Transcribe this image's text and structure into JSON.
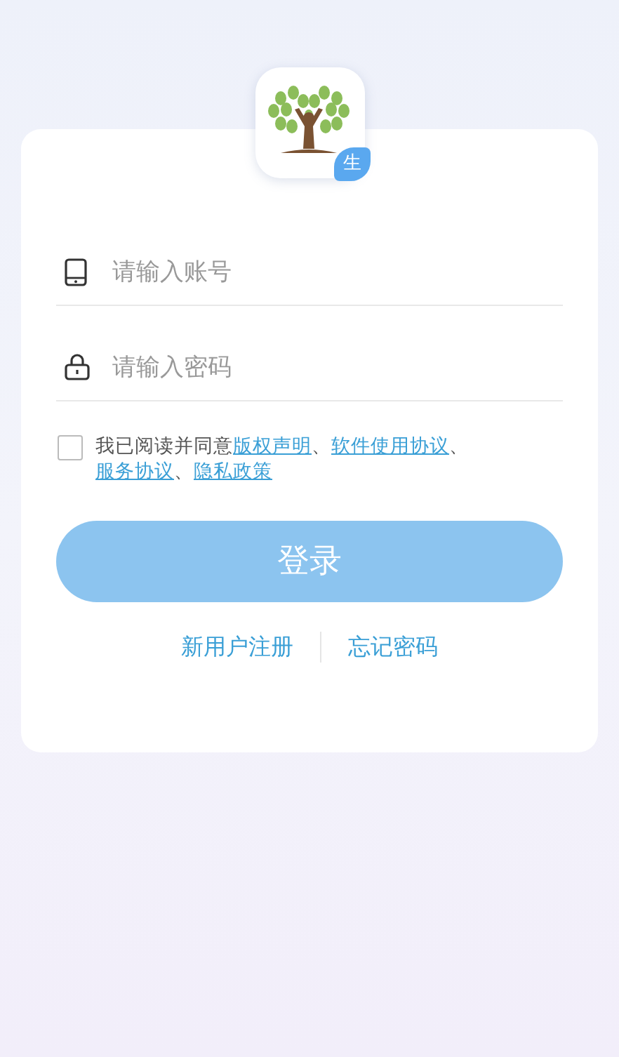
{
  "logo": {
    "badge": "生"
  },
  "fields": [
    {
      "kind": "account",
      "placeholder": "请输入账号"
    },
    {
      "kind": "password",
      "placeholder": "请输入密码"
    }
  ],
  "agreement": {
    "checked": false,
    "parts": [
      {
        "kind": "text",
        "text": "我已阅读并同意"
      },
      {
        "kind": "link",
        "text": "版权声明"
      },
      {
        "kind": "text",
        "text": "、"
      },
      {
        "kind": "link",
        "text": "软件使用协议"
      },
      {
        "kind": "text",
        "text": "、"
      },
      {
        "kind": "link",
        "text": "服务协议"
      },
      {
        "kind": "text",
        "text": "、"
      },
      {
        "kind": "link",
        "text": "隐私政策"
      }
    ]
  },
  "login_button": {
    "label": "登录",
    "disabled": true
  },
  "links": [
    "新用户注册",
    "忘记密码"
  ]
}
